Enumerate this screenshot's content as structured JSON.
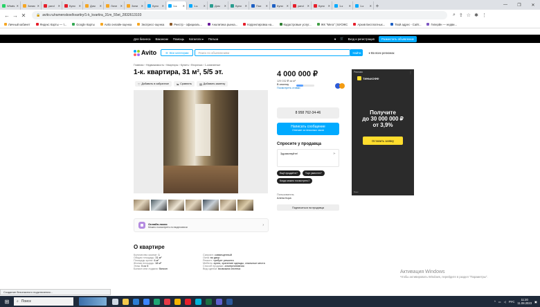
{
  "browser": {
    "tabs": [
      {
        "label": "Whats",
        "color": "#25d366"
      },
      {
        "label": "Запис",
        "color": "#f5a623"
      },
      {
        "label": "yand",
        "color": "#e61e2a"
      },
      {
        "label": "Купи",
        "color": "#e61e2a"
      },
      {
        "label": "Дом",
        "color": "#f5a623"
      },
      {
        "label": "Личн",
        "color": "#f5a623"
      },
      {
        "label": "Запи",
        "color": "#f5a623"
      },
      {
        "label": "Купи",
        "color": "#0af"
      },
      {
        "label": "1-к.",
        "color": "#0af"
      },
      {
        "label": "1-к.",
        "color": "#0af"
      },
      {
        "label": "Дом",
        "color": "#2a9d8f"
      },
      {
        "label": "Купи",
        "color": "#2a9d8f"
      },
      {
        "label": "Пои",
        "color": "#1d5fc3"
      },
      {
        "label": "Купи",
        "color": "#1d5fc3"
      },
      {
        "label": "yand",
        "color": "#e61e2a"
      },
      {
        "label": "Купи",
        "color": "#e61e2a"
      },
      {
        "label": "1-к",
        "color": "#0af"
      },
      {
        "label": "1-к",
        "color": "#0af"
      }
    ],
    "new_tab": "+",
    "url": "avito.ru/ramenskoe/kvartiry/1-k_kvartira_31m_55et_2832613103",
    "bookmarks": [
      {
        "label": "Личный кабинет",
        "color": "#f5a623"
      },
      {
        "label": "Яндекс Карты — т...",
        "color": "#e61e2a"
      },
      {
        "label": "Google Карты",
        "color": "#34a853"
      },
      {
        "label": "Avito онлайн-оценка",
        "color": "#f5a623"
      },
      {
        "label": "Экспресс-оценка",
        "color": "#f5a623"
      },
      {
        "label": "Реестр - официаль...",
        "color": "#8b5a2b"
      },
      {
        "label": "Аналитика рынка...",
        "color": "#6a1b9a"
      },
      {
        "label": "Корректировка на...",
        "color": "#e61e2a"
      },
      {
        "label": "Кадастровые услуг...",
        "color": "#2e7d32"
      },
      {
        "label": "ЖК \"Мега\" | БУОЖС",
        "color": "#43a047"
      },
      {
        "label": "Архив Бесплатных...",
        "color": "#e61e2a"
      },
      {
        "label": "Твой адрес - Сайт...",
        "color": "#1d5fc3"
      },
      {
        "label": "Гиперйн — недви...",
        "color": "#7e57c2"
      }
    ]
  },
  "topbar": {
    "left": [
      "Для бизнеса",
      "Вакансии",
      "Помощь",
      "Каталоги ▾",
      "Польза"
    ],
    "login": "Вход и регистрация",
    "post": "Разместить объявление"
  },
  "header": {
    "logo": "Avito",
    "categories": "Все категории",
    "search_placeholder": "Поиск по объявлениям",
    "find": "Найти",
    "region": "Во всех регионах"
  },
  "listing": {
    "breadcrumbs": "Главная › Недвижимость › Квартиры › Купить › Вторичка › 1-комнатные",
    "title": "1-к. квартира, 31 м², 5/5 эт.",
    "actions": [
      "Добавить в избранное",
      "Сравнить",
      "Добавить заметку"
    ],
    "online_title": "Онлайн-показ",
    "online_sub": "Можно посмотреть по видеосвязи"
  },
  "about": {
    "heading": "О квартире",
    "left": [
      {
        "k": "Количество комнат:",
        "v": "1"
      },
      {
        "k": "Общая площадь:",
        "v": "31 м²"
      },
      {
        "k": "Площадь кухни:",
        "v": "6 м²"
      },
      {
        "k": "Жилая площадь:",
        "v": "18 м²"
      },
      {
        "k": "Этаж:",
        "v": "5 из 5"
      },
      {
        "k": "Балкон или лоджия:",
        "v": "балкон"
      }
    ],
    "right": [
      {
        "k": "Санузел:",
        "v": "совмещенный"
      },
      {
        "k": "Окна:",
        "v": "во двор"
      },
      {
        "k": "Ремонт:",
        "v": "требует ремонта"
      },
      {
        "k": "Мебель:",
        "v": "кухня, хранение одежды, спальные места"
      },
      {
        "k": "Способ продажи:",
        "v": "альтернативная"
      },
      {
        "k": "Вид сделки:",
        "v": "возможна ипотека"
      }
    ]
  },
  "sidebar": {
    "price": "4 000 000 ₽",
    "per_m2": "129 032 ₽ за м²",
    "mortgage": "В ипотеку",
    "mortgage_link": "Посмотреть ставки",
    "mortgage_fill": 0.4,
    "phone": "8 958 762-34-46",
    "message": "Написать сообщение",
    "message_sub": "Отвечает за несколько часов",
    "ask_heading": "Спросите у продавца",
    "ask_text": "Здравствуйте!",
    "chips": [
      "Ещё продаёте?",
      "Торг уместен?",
      "Когда можно посмотреть?"
    ],
    "seller_label": "Пользователь",
    "seller_name": "Алена Кора",
    "subscribe": "Подписаться на продавца"
  },
  "ad": {
    "tag": "Реклама",
    "brand": "ТИНЬКОФФ",
    "headline_1": "Получите",
    "headline_2": "до 30 000 000 ₽",
    "headline_3": "от 3,9%",
    "cta": "Оставить заявку",
    "foot": "Банк"
  },
  "windows": {
    "activation_title": "Активация Windows",
    "activation_sub": "Чтобы активировать Windows, перейдите в раздел \"Параметры\".",
    "status": "Создание безопасного подключения...",
    "search": "Поиск",
    "lang": "РУС",
    "time": "11:20",
    "date": "11.08.2023"
  }
}
